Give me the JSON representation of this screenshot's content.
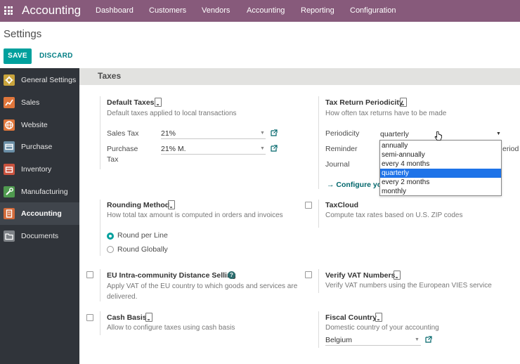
{
  "navbar": {
    "app_name": "Accounting",
    "menu": [
      "Dashboard",
      "Customers",
      "Vendors",
      "Accounting",
      "Reporting",
      "Configuration"
    ]
  },
  "control_panel": {
    "title": "Settings",
    "save": "SAVE",
    "discard": "DISCARD"
  },
  "sidebar": {
    "items": [
      {
        "label": "General Settings",
        "icon": "general-settings-icon",
        "color": "#c9a43c"
      },
      {
        "label": "Sales",
        "icon": "sales-chart-icon",
        "color": "#e0763b"
      },
      {
        "label": "Website",
        "icon": "website-globe-icon",
        "color": "#e0763b"
      },
      {
        "label": "Purchase",
        "icon": "purchase-card-icon",
        "color": "#6a8ea6"
      },
      {
        "label": "Inventory",
        "icon": "inventory-box-icon",
        "color": "#c9523e"
      },
      {
        "label": "Manufacturing",
        "icon": "manufacturing-wrench-icon",
        "color": "#4f9a4f"
      },
      {
        "label": "Accounting",
        "icon": "accounting-doc-icon",
        "color": "#d26a3a"
      },
      {
        "label": "Documents",
        "icon": "documents-folder-icon",
        "color": "#7e8287"
      }
    ],
    "active": "Accounting"
  },
  "section": {
    "title": "Taxes"
  },
  "default_taxes": {
    "title": "Default Taxes",
    "desc": "Default taxes applied to local transactions",
    "sales_label": "Sales Tax",
    "sales_value": "21%",
    "purchase_label_1": "Purchase",
    "purchase_label_2": "Tax",
    "purchase_value": "21% M."
  },
  "tax_return": {
    "title": "Tax Return Periodicity",
    "desc": "How often tax returns have to be made",
    "periodicity_label": "Periodicity",
    "periodicity_value": "quarterly",
    "reminder_label": "Reminder",
    "reminder_tail": "eriod",
    "journal_label": "Journal",
    "configure_link": "Configure you",
    "options": [
      "annually",
      "semi-annually",
      "every 4 months",
      "quarterly",
      "every 2 months",
      "monthly"
    ],
    "selected": "quarterly"
  },
  "rounding": {
    "title": "Rounding Method",
    "desc": "How total tax amount is computed in orders and invoices",
    "option_line": "Round per Line",
    "option_global": "Round Globally",
    "selected": "Round per Line"
  },
  "taxcloud": {
    "title": "TaxCloud",
    "desc": "Compute tax rates based on U.S. ZIP codes"
  },
  "eu_distance": {
    "title": "EU Intra-community Distance Selling",
    "desc_1": "Apply VAT of the EU country to which goods and services are",
    "desc_2": "delivered."
  },
  "vat_verify": {
    "title": "Verify VAT Numbers",
    "desc": "Verify VAT numbers using the European VIES service"
  },
  "cash_basis": {
    "title": "Cash Basis",
    "desc": "Allow to configure taxes using cash basis"
  },
  "fiscal_country": {
    "title": "Fiscal Country",
    "desc": "Domestic country of your accounting",
    "value": "Belgium"
  }
}
